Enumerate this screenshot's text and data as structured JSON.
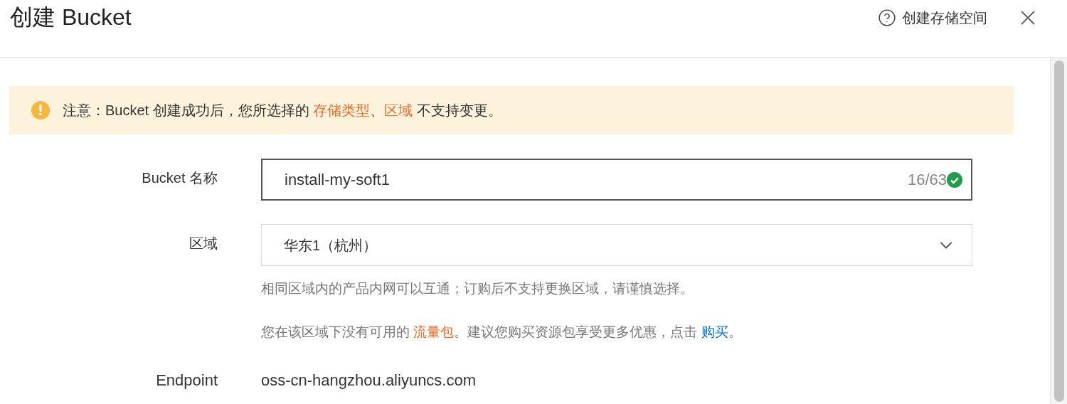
{
  "dialog": {
    "title": "创建 Bucket",
    "help_link": "创建存储空间"
  },
  "notice": {
    "parts": [
      {
        "kind": "plain",
        "text": "注意：Bucket 创建成功后，您所选择的 "
      },
      {
        "kind": "highlight",
        "text": "存储类型"
      },
      {
        "kind": "plain",
        "text": "、"
      },
      {
        "kind": "highlight",
        "text": "区域"
      },
      {
        "kind": "plain",
        "text": " 不支持变更。"
      }
    ]
  },
  "form": {
    "name_field": {
      "label": "Bucket 名称",
      "value": "install-my-soft1",
      "counter": "16/63",
      "valid": true
    },
    "region_field": {
      "label": "区域",
      "value": "华东1（杭州）"
    },
    "hints": [
      [
        {
          "kind": "plain",
          "text": "相同区域内的产品内网可以互通；订购后不支持更换区域，请谨慎选择。"
        }
      ],
      [
        {
          "kind": "plain",
          "text": "您在该区域下没有可用的 "
        },
        {
          "kind": "highlight",
          "text": "流量包"
        },
        {
          "kind": "plain",
          "text": "。建议您购买资源包享受更多优惠，点击 "
        },
        {
          "kind": "link",
          "text": "购买"
        },
        {
          "kind": "plain",
          "text": "。"
        }
      ]
    ],
    "endpoint": {
      "label": "Endpoint",
      "value": "oss-cn-hangzhou.aliyuncs.com"
    }
  }
}
